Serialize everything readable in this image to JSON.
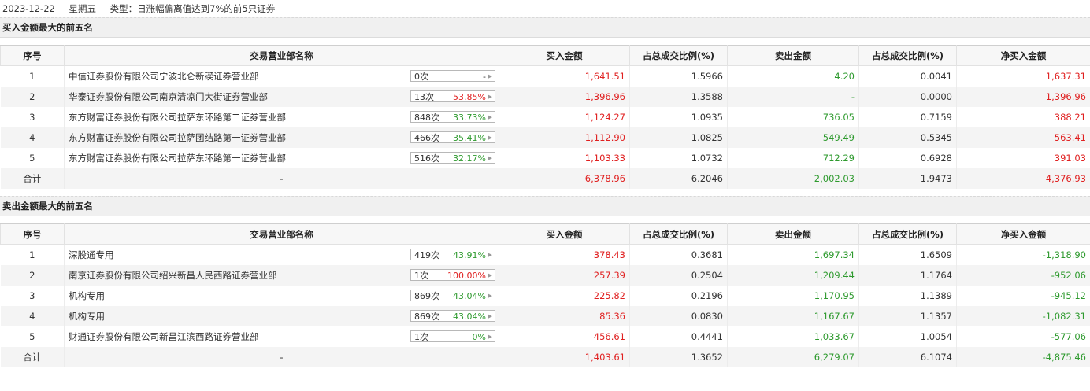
{
  "info": {
    "date": "2023-12-22",
    "weekday": "星期五",
    "type_label": "类型：日涨幅偏离值达到7%的前5只证券"
  },
  "buy_section": {
    "title": "买入金额最大的前五名"
  },
  "sell_section": {
    "title": "卖出金额最大的前五名"
  },
  "columns": [
    "序号",
    "交易营业部名称",
    "买入金额",
    "占总成交比例(%)",
    "卖出金额",
    "占总成交比例(%)",
    "净买入金额"
  ],
  "colors": {
    "red": "#e02020",
    "green": "#2e9a2e"
  },
  "buy_rows": [
    {
      "idx": "1",
      "name": "中信证券股份有限公司宁波北仑新碶证券营业部",
      "count": "0次",
      "pct": "-",
      "pct_color": "dark",
      "buy": "1,641.51",
      "buy_ratio": "1.5966",
      "sell": "4.20",
      "sell_ratio": "0.0041",
      "net": "1,637.31",
      "net_color": "red"
    },
    {
      "idx": "2",
      "name": "华泰证券股份有限公司南京清凉门大街证券营业部",
      "count": "13次",
      "pct": "53.85%",
      "pct_color": "red",
      "buy": "1,396.96",
      "buy_ratio": "1.3588",
      "sell": "-",
      "sell_ratio": "0.0000",
      "net": "1,396.96",
      "net_color": "red"
    },
    {
      "idx": "3",
      "name": "东方财富证券股份有限公司拉萨东环路第二证券营业部",
      "count": "848次",
      "pct": "33.73%",
      "pct_color": "green",
      "buy": "1,124.27",
      "buy_ratio": "1.0935",
      "sell": "736.05",
      "sell_ratio": "0.7159",
      "net": "388.21",
      "net_color": "red"
    },
    {
      "idx": "4",
      "name": "东方财富证券股份有限公司拉萨团结路第一证券营业部",
      "count": "466次",
      "pct": "35.41%",
      "pct_color": "green",
      "buy": "1,112.90",
      "buy_ratio": "1.0825",
      "sell": "549.49",
      "sell_ratio": "0.5345",
      "net": "563.41",
      "net_color": "red"
    },
    {
      "idx": "5",
      "name": "东方财富证券股份有限公司拉萨东环路第一证券营业部",
      "count": "516次",
      "pct": "32.17%",
      "pct_color": "green",
      "buy": "1,103.33",
      "buy_ratio": "1.0732",
      "sell": "712.29",
      "sell_ratio": "0.6928",
      "net": "391.03",
      "net_color": "red"
    }
  ],
  "buy_total": {
    "label": "合计",
    "name": "-",
    "buy": "6,378.96",
    "buy_ratio": "6.2046",
    "sell": "2,002.03",
    "sell_ratio": "1.9473",
    "net": "4,376.93",
    "net_color": "red"
  },
  "sell_rows": [
    {
      "idx": "1",
      "name": "深股通专用",
      "count": "419次",
      "pct": "43.91%",
      "pct_color": "green",
      "buy": "378.43",
      "buy_ratio": "0.3681",
      "sell": "1,697.34",
      "sell_ratio": "1.6509",
      "net": "-1,318.90",
      "net_color": "green"
    },
    {
      "idx": "2",
      "name": "南京证券股份有限公司绍兴新昌人民西路证券营业部",
      "count": "1次",
      "pct": "100.00%",
      "pct_color": "red",
      "buy": "257.39",
      "buy_ratio": "0.2504",
      "sell": "1,209.44",
      "sell_ratio": "1.1764",
      "net": "-952.06",
      "net_color": "green"
    },
    {
      "idx": "3",
      "name": "机构专用",
      "count": "869次",
      "pct": "43.04%",
      "pct_color": "green",
      "buy": "225.82",
      "buy_ratio": "0.2196",
      "sell": "1,170.95",
      "sell_ratio": "1.1389",
      "net": "-945.12",
      "net_color": "green"
    },
    {
      "idx": "4",
      "name": "机构专用",
      "count": "869次",
      "pct": "43.04%",
      "pct_color": "green",
      "buy": "85.36",
      "buy_ratio": "0.0830",
      "sell": "1,167.67",
      "sell_ratio": "1.1357",
      "net": "-1,082.31",
      "net_color": "green"
    },
    {
      "idx": "5",
      "name": "财通证券股份有限公司新昌江滨西路证券营业部",
      "count": "1次",
      "pct": "0%",
      "pct_color": "green",
      "buy": "456.61",
      "buy_ratio": "0.4441",
      "sell": "1,033.67",
      "sell_ratio": "1.0054",
      "net": "-577.06",
      "net_color": "green"
    }
  ],
  "sell_total": {
    "label": "合计",
    "name": "-",
    "buy": "1,403.61",
    "buy_ratio": "1.3652",
    "sell": "6,279.07",
    "sell_ratio": "6.1074",
    "net": "-4,875.46",
    "net_color": "green"
  }
}
